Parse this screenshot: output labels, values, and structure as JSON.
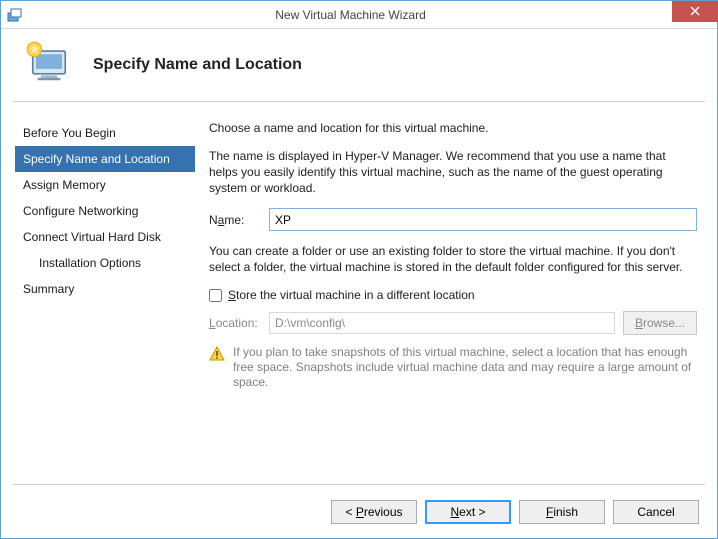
{
  "titlebar": {
    "title": "New Virtual Machine Wizard"
  },
  "header": {
    "heading": "Specify Name and Location"
  },
  "sidebar": {
    "items": [
      {
        "label": "Before You Begin"
      },
      {
        "label": "Specify Name and Location"
      },
      {
        "label": "Assign Memory"
      },
      {
        "label": "Configure Networking"
      },
      {
        "label": "Connect Virtual Hard Disk"
      },
      {
        "label": "Installation Options"
      },
      {
        "label": "Summary"
      }
    ]
  },
  "content": {
    "intro": "Choose a name and location for this virtual machine.",
    "name_help": "The name is displayed in Hyper-V Manager. We recommend that you use a name that helps you easily identify this virtual machine, such as the name of the guest operating system or workload.",
    "name_label": "Name:",
    "name_value": "XP",
    "folder_help": "You can create a folder or use an existing folder to store the virtual machine. If you don't select a folder, the virtual machine is stored in the default folder configured for this server.",
    "store_checkbox_label": "Store the virtual machine in a different location",
    "store_checked": false,
    "location_label": "Location:",
    "location_value": "D:\\vm\\config\\",
    "browse_label": "Browse...",
    "warning": "If you plan to take snapshots of this virtual machine, select a location that has enough free space. Snapshots include virtual machine data and may require a large amount of space."
  },
  "footer": {
    "previous": "< Previous",
    "next": "Next >",
    "finish": "Finish",
    "cancel": "Cancel"
  }
}
